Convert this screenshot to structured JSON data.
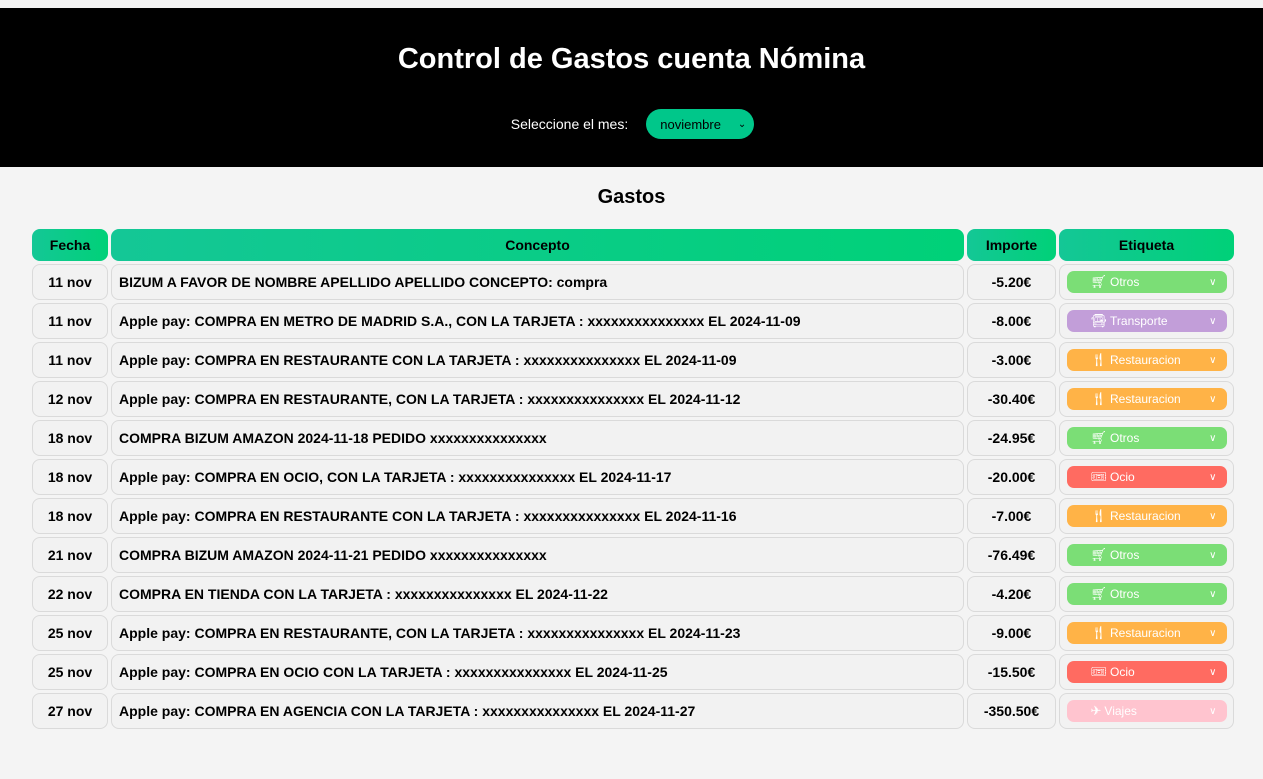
{
  "header": {
    "title": "Control de Gastos cuenta Nómina",
    "month_label": "Seleccione el mes:",
    "month_selected": "noviembre"
  },
  "section_title": "Gastos",
  "columns": [
    "Fecha",
    "Concepto",
    "Importe",
    "Etiqueta"
  ],
  "tag_colors": {
    "Otros": "#7bde76",
    "Transporte": "#c29ed9",
    "Restauracion": "#ffb347",
    "Ocio": "#ff6b61",
    "Viajes": "#ffc4cf"
  },
  "rows": [
    {
      "fecha": "11 nov",
      "concepto": "BIZUM A FAVOR DE NOMBRE APELLIDO APELLIDO CONCEPTO: compra",
      "importe": "-5.20€",
      "etiqueta": "Otros",
      "icon": "cart-icon"
    },
    {
      "fecha": "11 nov",
      "concepto": "Apple pay: COMPRA EN METRO DE MADRID S.A., CON LA TARJETA : xxxxxxxxxxxxxxx EL 2024-11-09",
      "importe": "-8.00€",
      "etiqueta": "Transporte",
      "icon": "bus-icon"
    },
    {
      "fecha": "11 nov",
      "concepto": "Apple pay: COMPRA EN RESTAURANTE CON LA TARJETA : xxxxxxxxxxxxxxx EL 2024-11-09",
      "importe": "-3.00€",
      "etiqueta": "Restauracion",
      "icon": "utensils-icon"
    },
    {
      "fecha": "12 nov",
      "concepto": "Apple pay: COMPRA EN RESTAURANTE, CON LA TARJETA : xxxxxxxxxxxxxxx EL 2024-11-12",
      "importe": "-30.40€",
      "etiqueta": "Restauracion",
      "icon": "utensils-icon"
    },
    {
      "fecha": "18 nov",
      "concepto": "COMPRA BIZUM AMAZON 2024-11-18 PEDIDO xxxxxxxxxxxxxxx",
      "importe": "-24.95€",
      "etiqueta": "Otros",
      "icon": "cart-icon"
    },
    {
      "fecha": "18 nov",
      "concepto": "Apple pay: COMPRA EN OCIO, CON LA TARJETA : xxxxxxxxxxxxxxx EL 2024-11-17",
      "importe": "-20.00€",
      "etiqueta": "Ocio",
      "icon": "ticket-icon"
    },
    {
      "fecha": "18 nov",
      "concepto": "Apple pay: COMPRA EN RESTAURANTE CON LA TARJETA : xxxxxxxxxxxxxxx EL 2024-11-16",
      "importe": "-7.00€",
      "etiqueta": "Restauracion",
      "icon": "utensils-icon"
    },
    {
      "fecha": "21 nov",
      "concepto": "COMPRA BIZUM AMAZON 2024-11-21 PEDIDO xxxxxxxxxxxxxxx",
      "importe": "-76.49€",
      "etiqueta": "Otros",
      "icon": "cart-icon"
    },
    {
      "fecha": "22 nov",
      "concepto": "COMPRA EN TIENDA CON LA TARJETA : xxxxxxxxxxxxxxx EL 2024-11-22",
      "importe": "-4.20€",
      "etiqueta": "Otros",
      "icon": "cart-icon"
    },
    {
      "fecha": "25 nov",
      "concepto": "Apple pay: COMPRA EN RESTAURANTE, CON LA TARJETA : xxxxxxxxxxxxxxx EL 2024-11-23",
      "importe": "-9.00€",
      "etiqueta": "Restauracion",
      "icon": "utensils-icon"
    },
    {
      "fecha": "25 nov",
      "concepto": "Apple pay: COMPRA EN OCIO CON LA TARJETA : xxxxxxxxxxxxxxx EL 2024-11-25",
      "importe": "-15.50€",
      "etiqueta": "Ocio",
      "icon": "ticket-icon"
    },
    {
      "fecha": "27 nov",
      "concepto": "Apple pay: COMPRA EN AGENCIA CON LA TARJETA : xxxxxxxxxxxxxxx EL 2024-11-27",
      "importe": "-350.50€",
      "etiqueta": "Viajes",
      "icon": "plane-icon"
    }
  ]
}
